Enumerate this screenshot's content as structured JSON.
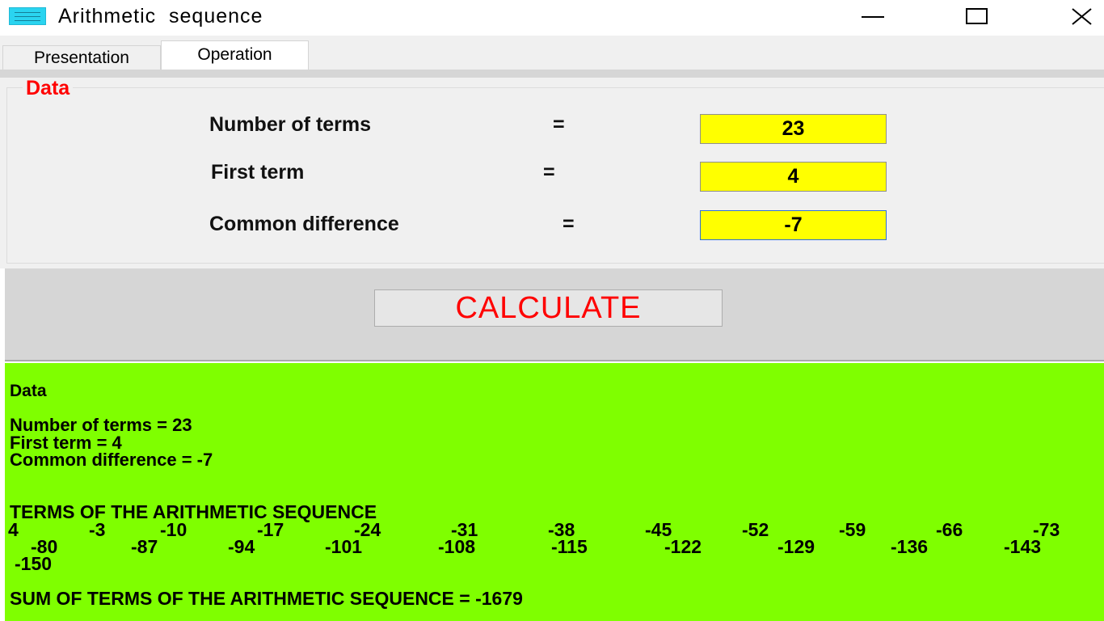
{
  "window": {
    "title": "Arithmetic  sequence",
    "icon": "app-icon",
    "controls": [
      "minimize-icon",
      "maximize-icon",
      "close-icon"
    ]
  },
  "tabs": [
    {
      "label": "Presentation",
      "active": false
    },
    {
      "label": "Operation",
      "active": true
    }
  ],
  "data_group": {
    "legend": "Data",
    "fields": {
      "terms": {
        "label": "Number of terms",
        "eq": "=",
        "value": "23"
      },
      "first": {
        "label": "First term",
        "eq": "=",
        "value": "4"
      },
      "diff": {
        "label": "Common difference",
        "eq": "=",
        "value": "-7"
      }
    }
  },
  "calculate": {
    "label": "CALCULATE"
  },
  "output": {
    "heading": "Data",
    "terms_line": "Number of terms = 23",
    "first_line": "First term = 4",
    "diff_line": "Common difference = -7",
    "terms_heading": "TERMS OF THE ARITHMETIC SEQUENCE",
    "terms_row1": [
      "4",
      "-3",
      "-10",
      "-17",
      "-24",
      "-31",
      "-38",
      "-45",
      "-52",
      "-59",
      "-66",
      "-73"
    ],
    "terms_row2": [
      "-80",
      "-87",
      "-94",
      "-101",
      "-108",
      "-115",
      "-122",
      "-129",
      "-136",
      "-143"
    ],
    "terms_row3": [
      "-150"
    ],
    "sum_line": "SUM OF TERMS OF THE ARITHMETIC SEQUENCE = -1679"
  },
  "colors": {
    "input_bg": "#ffff00",
    "output_bg": "#7fff00",
    "accent_red": "#ff0000"
  }
}
